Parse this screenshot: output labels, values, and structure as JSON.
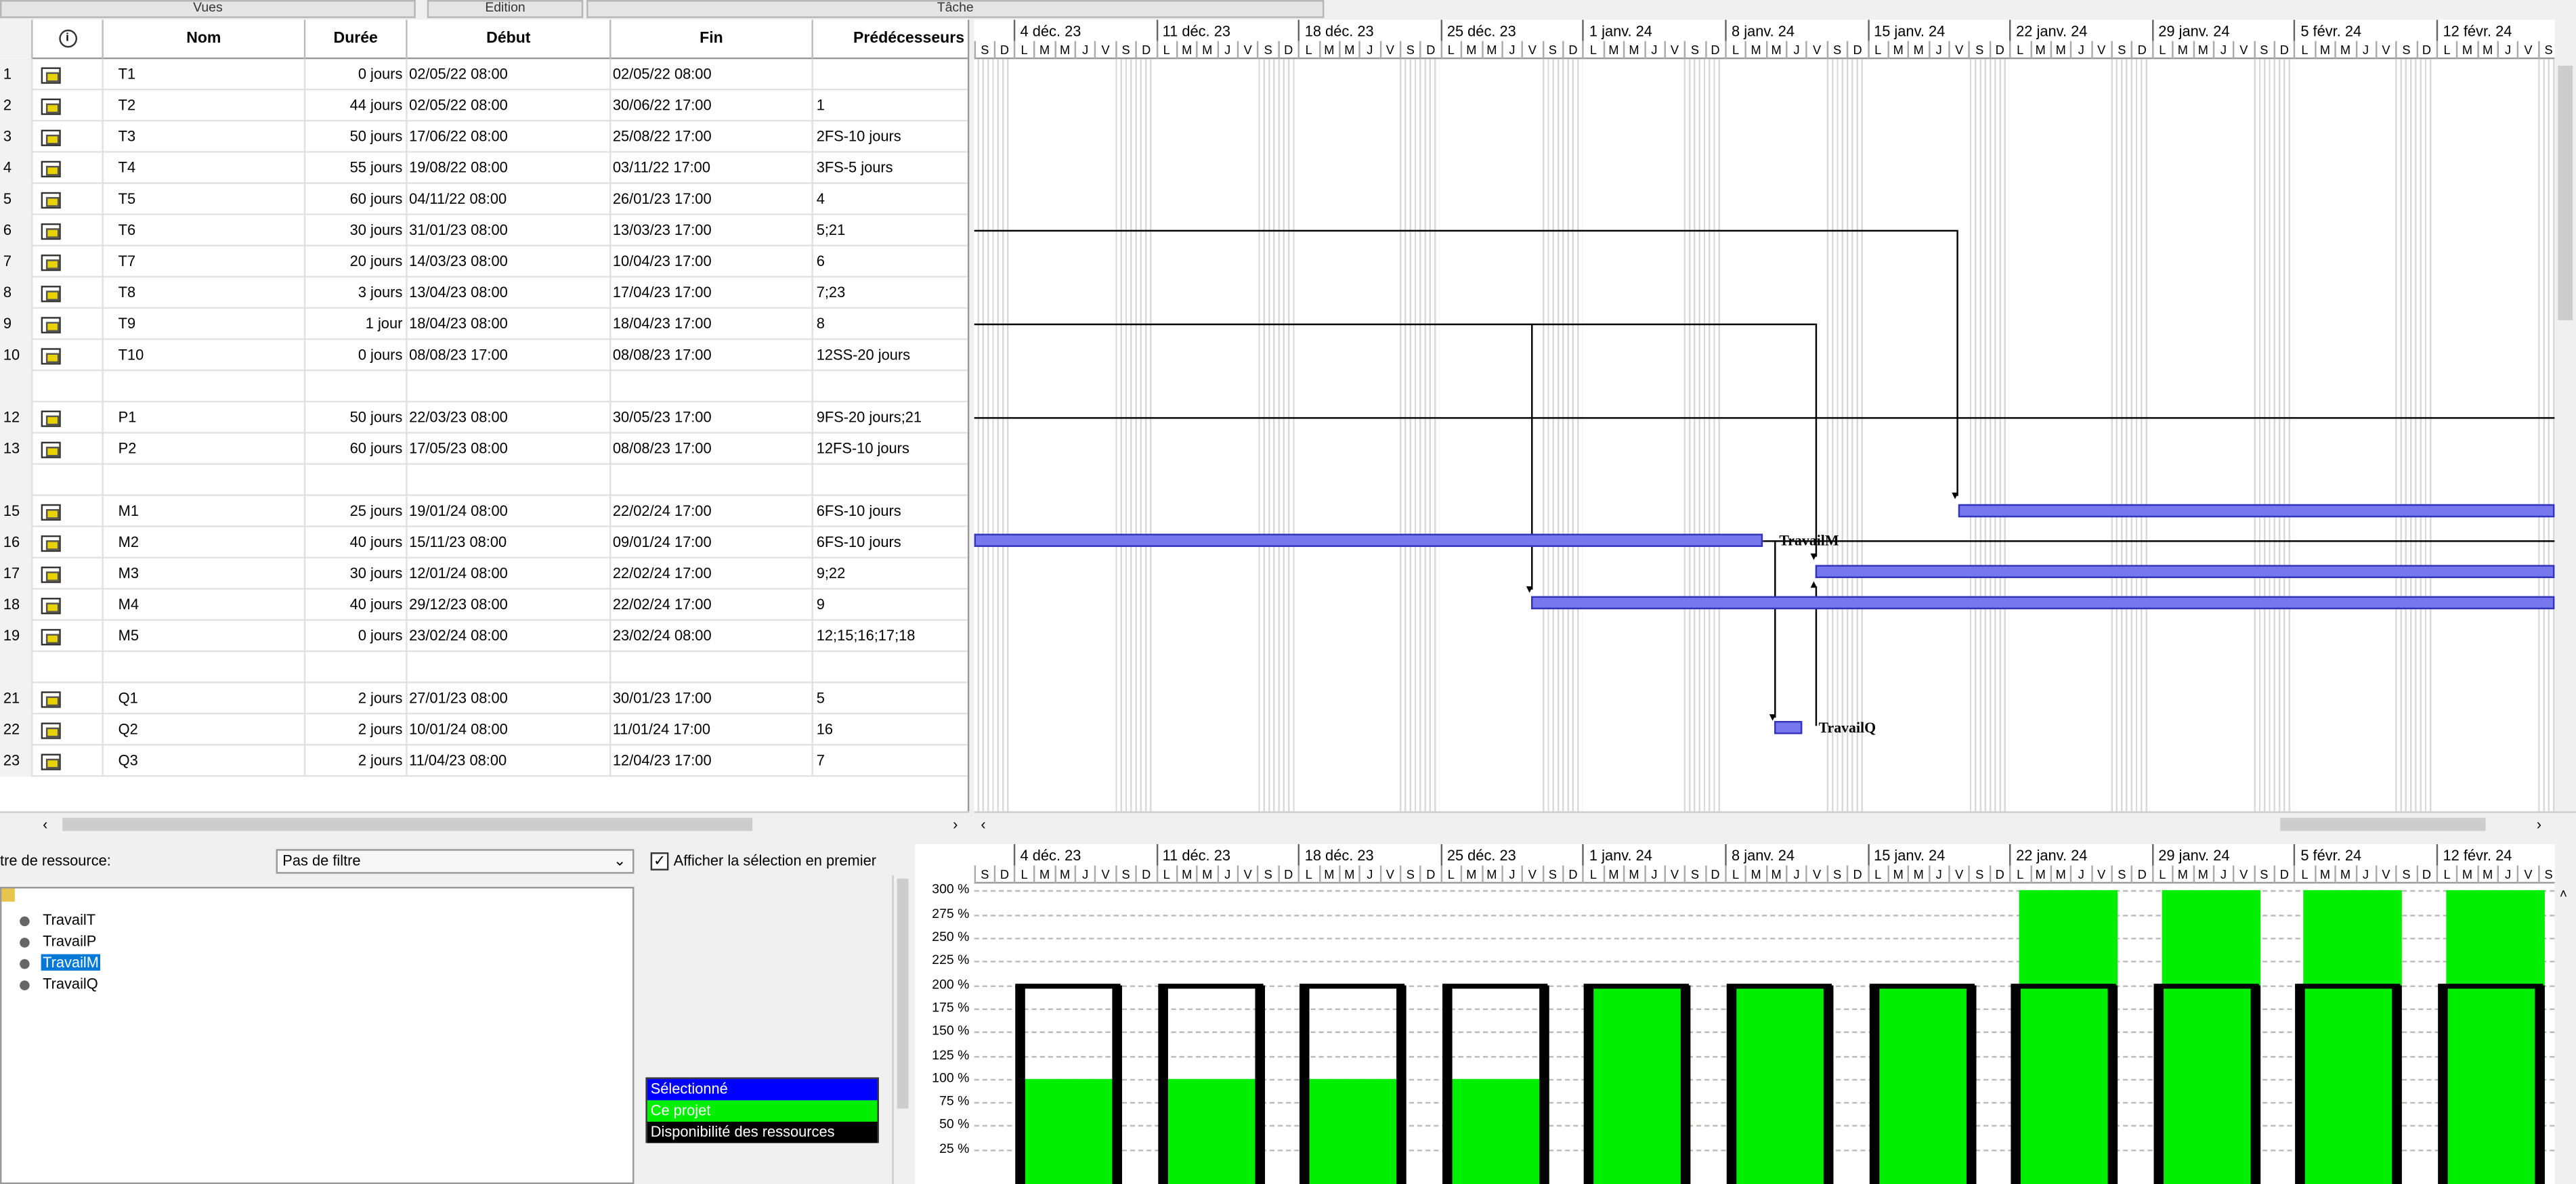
{
  "toolbar": {
    "views": "Vues",
    "edit": "Edition",
    "task": "Tâche"
  },
  "table": {
    "columns": [
      "Nom",
      "Durée",
      "Début",
      "Fin",
      "Prédécesseurs"
    ],
    "rows": [
      {
        "n": "1",
        "name": "T1",
        "dur": "0 jours",
        "start": "02/05/22 08:00",
        "end": "02/05/22 08:00",
        "pred": ""
      },
      {
        "n": "2",
        "name": "T2",
        "dur": "44 jours",
        "start": "02/05/22 08:00",
        "end": "30/06/22 17:00",
        "pred": "1"
      },
      {
        "n": "3",
        "name": "T3",
        "dur": "50 jours",
        "start": "17/06/22 08:00",
        "end": "25/08/22 17:00",
        "pred": "2FS-10 jours"
      },
      {
        "n": "4",
        "name": "T4",
        "dur": "55 jours",
        "start": "19/08/22 08:00",
        "end": "03/11/22 17:00",
        "pred": "3FS-5 jours"
      },
      {
        "n": "5",
        "name": "T5",
        "dur": "60 jours",
        "start": "04/11/22 08:00",
        "end": "26/01/23 17:00",
        "pred": "4"
      },
      {
        "n": "6",
        "name": "T6",
        "dur": "30 jours",
        "start": "31/01/23 08:00",
        "end": "13/03/23 17:00",
        "pred": "5;21"
      },
      {
        "n": "7",
        "name": "T7",
        "dur": "20 jours",
        "start": "14/03/23 08:00",
        "end": "10/04/23 17:00",
        "pred": "6"
      },
      {
        "n": "8",
        "name": "T8",
        "dur": "3 jours",
        "start": "13/04/23 08:00",
        "end": "17/04/23 17:00",
        "pred": "7;23"
      },
      {
        "n": "9",
        "name": "T9",
        "dur": "1 jour",
        "start": "18/04/23 08:00",
        "end": "18/04/23 17:00",
        "pred": "8"
      },
      {
        "n": "10",
        "name": "T10",
        "dur": "0 jours",
        "start": "08/08/23 17:00",
        "end": "08/08/23 17:00",
        "pred": "12SS-20 jours"
      },
      {
        "n": "",
        "name": "",
        "dur": "",
        "start": "",
        "end": "",
        "pred": ""
      },
      {
        "n": "12",
        "name": "P1",
        "dur": "50 jours",
        "start": "22/03/23 08:00",
        "end": "30/05/23 17:00",
        "pred": "9FS-20 jours;21"
      },
      {
        "n": "13",
        "name": "P2",
        "dur": "60 jours",
        "start": "17/05/23 08:00",
        "end": "08/08/23 17:00",
        "pred": "12FS-10 jours"
      },
      {
        "n": "",
        "name": "",
        "dur": "",
        "start": "",
        "end": "",
        "pred": ""
      },
      {
        "n": "15",
        "name": "M1",
        "dur": "25 jours",
        "start": "19/01/24 08:00",
        "end": "22/02/24 17:00",
        "pred": "6FS-10 jours"
      },
      {
        "n": "16",
        "name": "M2",
        "dur": "40 jours",
        "start": "15/11/23 08:00",
        "end": "09/01/24 17:00",
        "pred": "6FS-10 jours"
      },
      {
        "n": "17",
        "name": "M3",
        "dur": "30 jours",
        "start": "12/01/24 08:00",
        "end": "22/02/24 17:00",
        "pred": "9;22"
      },
      {
        "n": "18",
        "name": "M4",
        "dur": "40 jours",
        "start": "29/12/23 08:00",
        "end": "22/02/24 17:00",
        "pred": "9"
      },
      {
        "n": "19",
        "name": "M5",
        "dur": "0 jours",
        "start": "23/02/24 08:00",
        "end": "23/02/24 08:00",
        "pred": "12;15;16;17;18"
      },
      {
        "n": "",
        "name": "",
        "dur": "",
        "start": "",
        "end": "",
        "pred": ""
      },
      {
        "n": "21",
        "name": "Q1",
        "dur": "2 jours",
        "start": "27/01/23 08:00",
        "end": "30/01/23 17:00",
        "pred": "5"
      },
      {
        "n": "22",
        "name": "Q2",
        "dur": "2 jours",
        "start": "10/01/24 08:00",
        "end": "11/01/24 17:00",
        "pred": "16"
      },
      {
        "n": "23",
        "name": "Q3",
        "dur": "2 jours",
        "start": "11/04/23 08:00",
        "end": "12/04/23 17:00",
        "pred": "7"
      }
    ]
  },
  "timeline": {
    "weeks": [
      "4 déc. 23",
      "11 déc. 23",
      "18 déc. 23",
      "25 déc. 23",
      "1 janv. 24",
      "8 janv. 24",
      "15 janv. 24",
      "22 janv. 24",
      "29 janv. 24",
      "5 févr. 24",
      "12 févr. 24"
    ],
    "first_days": [
      "S",
      "D"
    ],
    "days": [
      "L",
      "M",
      "M",
      "J",
      "V",
      "S",
      "D"
    ]
  },
  "gantt": {
    "label_m2": "TravailM",
    "label_q2": "TravailQ"
  },
  "resources": {
    "filter_label": "tre de ressource:",
    "filter_value": "Pas de filtre",
    "show_selection_first": "Afficher la sélection en premier",
    "items": [
      "TravailT",
      "TravailP",
      "TravailM",
      "TravailQ"
    ],
    "selected": "TravailM"
  },
  "legend": [
    {
      "label": "Sélectionné",
      "color": "#0000ff"
    },
    {
      "label": "Ce projet",
      "color": "#00ee00"
    },
    {
      "label": "Disponibilité des ressources",
      "color": "#000000"
    }
  ],
  "histogram": {
    "y_ticks": [
      "300 %",
      "275 %",
      "250 %",
      "225 %",
      "200 %",
      "175 %",
      "150 %",
      "125 %",
      "100 %",
      "75 %",
      "50 %",
      "25 %"
    ],
    "availability_pct": 200,
    "weeks": [
      {
        "week": "4 déc. 23",
        "load_pct": 100
      },
      {
        "week": "11 déc. 23",
        "load_pct": 100
      },
      {
        "week": "18 déc. 23",
        "load_pct": 100
      },
      {
        "week": "25 déc. 23",
        "load_pct": 100
      },
      {
        "week": "1 janv. 24",
        "load_pct": 200
      },
      {
        "week": "8 janv. 24",
        "load_pct": 200
      },
      {
        "week": "15 janv. 24",
        "load_pct": 200
      },
      {
        "week": "22 janv. 24",
        "load_pct": 300
      },
      {
        "week": "29 janv. 24",
        "load_pct": 300
      },
      {
        "week": "5 févr. 24",
        "load_pct": 300
      },
      {
        "week": "12 févr. 24",
        "load_pct": 300
      }
    ]
  }
}
